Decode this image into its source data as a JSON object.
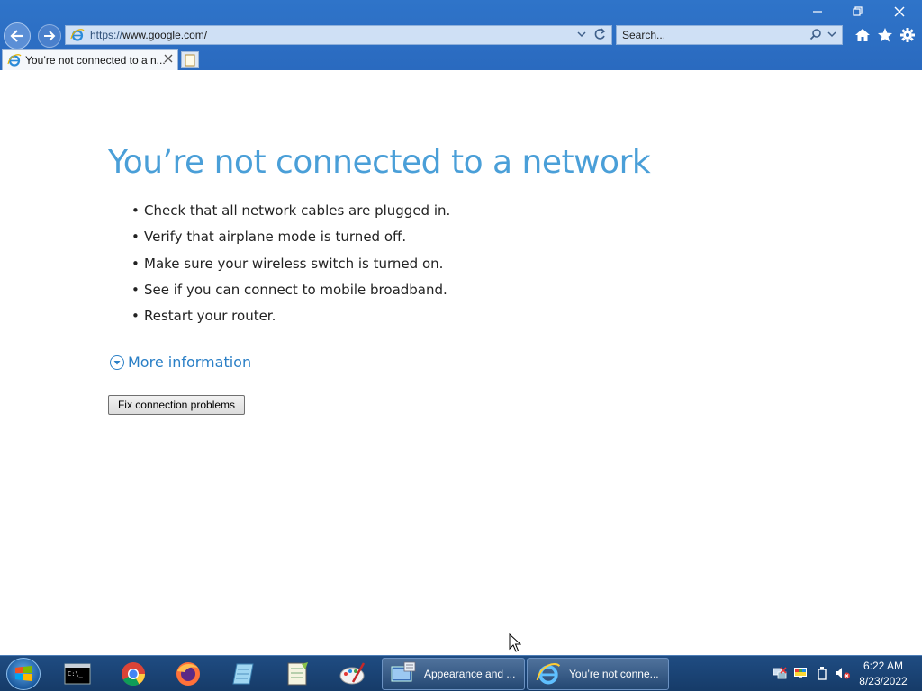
{
  "browser": {
    "address": {
      "scheme": "https://",
      "host": "www.google.com/"
    },
    "search": {
      "placeholder": "Search..."
    },
    "tab": {
      "title": "You’re not connected to a n..."
    }
  },
  "page": {
    "title": "You’re not connected to a network",
    "bullets": [
      "Check that all network cables are plugged in.",
      "Verify that airplane mode is turned off.",
      "Make sure your wireless switch is turned on.",
      "See if you can connect to mobile broadband.",
      "Restart your router."
    ],
    "more_info": "More information",
    "fix_button": "Fix connection problems"
  },
  "taskbar": {
    "tasks": [
      {
        "label": "Appearance and ...",
        "icon": "control-panel-icon"
      },
      {
        "label": "You’re not conne...",
        "icon": "internet-explorer-icon"
      }
    ],
    "pinned": [
      "command-prompt-icon",
      "chrome-icon",
      "firefox-icon",
      "notepad-icon",
      "notepad-plus-plus-icon",
      "paint-icon"
    ],
    "clock": {
      "time": "6:22 AM",
      "date": "8/23/2022"
    }
  },
  "colors": {
    "chrome_blue": "#2b6fc4",
    "title_blue": "#4a9fd8",
    "link_blue": "#2a7fc6",
    "taskbar": "#1a4474"
  }
}
